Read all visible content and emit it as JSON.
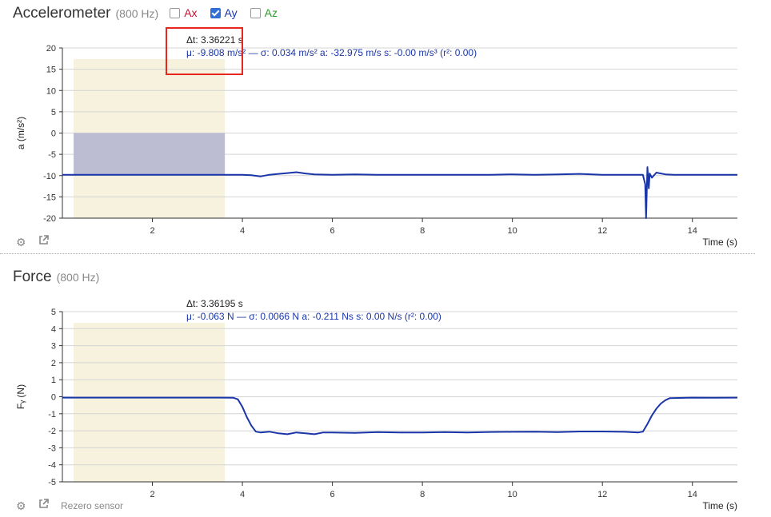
{
  "accelerometer": {
    "title": "Accelerometer",
    "rate": "(800 Hz)",
    "toggles": [
      {
        "label": "Ax",
        "checked": false,
        "color": "#c8102e"
      },
      {
        "label": "Ay",
        "checked": true,
        "color": "#1a35a8"
      },
      {
        "label": "Az",
        "checked": false,
        "color": "#2a9d2a"
      }
    ],
    "readout": {
      "dt": "Δt: 3.36221 s",
      "stats": "μ: -9.808 m/s² — σ: 0.034 m/s²   a: -32.975 m/s   s: -0.00 m/s³ (r²: 0.00)"
    },
    "settings_icon": "gear-icon",
    "popout_icon": "external-link-icon"
  },
  "force": {
    "title": "Force",
    "rate": "(800 Hz)",
    "readout": {
      "dt": "Δt: 3.36195 s",
      "stats": "μ: -0.063 N — σ: 0.0066 N   a: -0.211 Ns   s: 0.00 N/s (r²: 0.00)"
    },
    "rezero_label": "Rezero sensor",
    "settings_icon": "gear-icon",
    "popout_icon": "external-link-icon"
  },
  "chart_data": [
    {
      "type": "line",
      "title": "Accelerometer",
      "xlabel": "Time (s)",
      "ylabel": "a (m/s²)",
      "xlim": [
        0,
        15
      ],
      "ylim": [
        -20,
        20
      ],
      "xticks": [
        2,
        4,
        6,
        8,
        10,
        12,
        14
      ],
      "yticks": [
        20,
        15,
        10,
        5,
        0,
        -5,
        -10,
        -15,
        -20
      ],
      "grid": true,
      "selection": {
        "x_start": 0.25,
        "x_end": 3.61,
        "mean": -9.808
      },
      "series": [
        {
          "name": "Ay",
          "color": "#1a35a8",
          "x": [
            0,
            0.5,
            1,
            1.5,
            2,
            2.5,
            3,
            3.5,
            4,
            4.2,
            4.4,
            4.6,
            4.8,
            5.0,
            5.2,
            5.4,
            5.6,
            6,
            6.5,
            7,
            7.5,
            8,
            8.5,
            9,
            9.5,
            10,
            10.5,
            11,
            11.5,
            12,
            12.5,
            12.9,
            12.95,
            12.97,
            13.0,
            13.03,
            13.05,
            13.1,
            13.2,
            13.3,
            13.4,
            13.6,
            14,
            14.5,
            15
          ],
          "y": [
            -9.8,
            -9.8,
            -9.8,
            -9.8,
            -9.8,
            -9.8,
            -9.8,
            -9.8,
            -9.8,
            -9.9,
            -10.2,
            -9.8,
            -9.6,
            -9.4,
            -9.2,
            -9.5,
            -9.7,
            -9.8,
            -9.7,
            -9.8,
            -9.8,
            -9.8,
            -9.8,
            -9.8,
            -9.8,
            -9.7,
            -9.8,
            -9.7,
            -9.6,
            -9.8,
            -9.8,
            -9.8,
            -12,
            -20,
            -8,
            -13,
            -9.5,
            -10.5,
            -9.3,
            -9.5,
            -9.7,
            -9.8,
            -9.8,
            -9.8,
            -9.8
          ]
        }
      ]
    },
    {
      "type": "line",
      "title": "Force",
      "xlabel": "Time (s)",
      "ylabel": "Fᵧ (N)",
      "xlim": [
        0,
        15
      ],
      "ylim": [
        -5,
        5
      ],
      "xticks": [
        2,
        4,
        6,
        8,
        10,
        12,
        14
      ],
      "yticks": [
        5,
        4,
        3,
        2,
        1,
        0,
        -1,
        -2,
        -3,
        -4,
        -5
      ],
      "grid": true,
      "selection": {
        "x_start": 0.25,
        "x_end": 3.61,
        "mean": -0.063
      },
      "series": [
        {
          "name": "Fᵧ",
          "color": "#1a35a8",
          "x": [
            0,
            0.5,
            1,
            1.5,
            2,
            2.5,
            3,
            3.5,
            3.8,
            3.9,
            4.0,
            4.1,
            4.2,
            4.3,
            4.4,
            4.6,
            4.8,
            5.0,
            5.2,
            5.4,
            5.6,
            5.8,
            6,
            6.5,
            7,
            7.5,
            8,
            8.5,
            9,
            9.5,
            10,
            10.5,
            11,
            11.5,
            12,
            12.5,
            12.8,
            12.9,
            13.0,
            13.1,
            13.2,
            13.3,
            13.4,
            13.5,
            14,
            14.5,
            15
          ],
          "y": [
            -0.05,
            -0.05,
            -0.05,
            -0.05,
            -0.05,
            -0.05,
            -0.05,
            -0.05,
            -0.06,
            -0.15,
            -0.6,
            -1.2,
            -1.7,
            -2.05,
            -2.1,
            -2.05,
            -2.15,
            -2.2,
            -2.1,
            -2.15,
            -2.2,
            -2.1,
            -2.1,
            -2.12,
            -2.08,
            -2.1,
            -2.1,
            -2.08,
            -2.1,
            -2.07,
            -2.06,
            -2.05,
            -2.08,
            -2.04,
            -2.04,
            -2.06,
            -2.1,
            -2.05,
            -1.6,
            -1.1,
            -0.7,
            -0.4,
            -0.2,
            -0.08,
            -0.05,
            -0.06,
            -0.05
          ]
        }
      ]
    }
  ]
}
